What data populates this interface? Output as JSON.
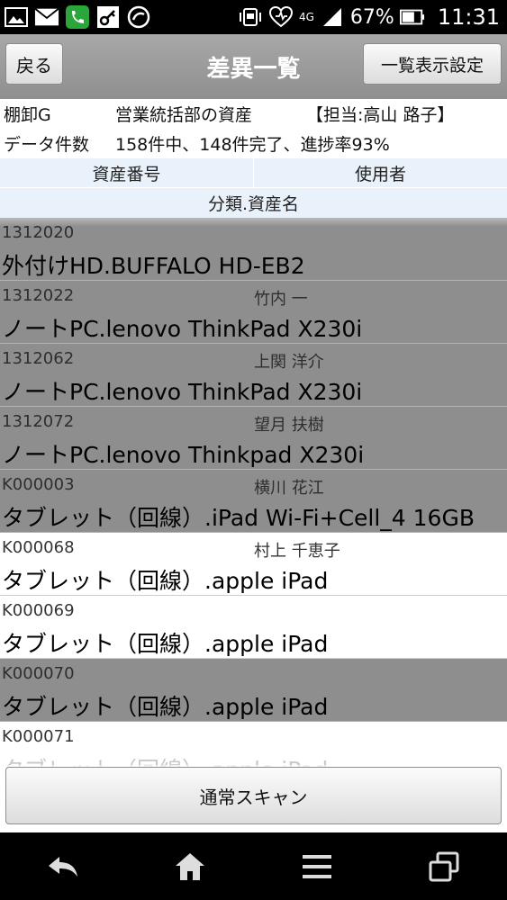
{
  "status_bar": {
    "battery_percent": "67%",
    "network": "4G",
    "time": "11:31"
  },
  "header": {
    "back_label": "戻る",
    "title": "差異一覧",
    "settings_label": "一覧表示設定"
  },
  "info": {
    "group": "棚卸G",
    "department": "営業統括部の資産",
    "owner": "【担当:高山 路子】",
    "count_label": "データ件数",
    "count_value": "158件中、148件完了、進捗率93%"
  },
  "columns": {
    "asset_no": "資産番号",
    "user": "使用者",
    "category_name": "分類.資産名"
  },
  "rows": [
    {
      "asset_no": "1312020",
      "user": "",
      "name": "外付けHD.BUFFALO HD-EB2",
      "style": "gray"
    },
    {
      "asset_no": "1312022",
      "user": "竹内 一",
      "name": "ノートPC.lenovo ThinkPad X230i",
      "style": "gray"
    },
    {
      "asset_no": "1312062",
      "user": "上関 洋介",
      "name": "ノートPC.lenovo ThinkPad X230i",
      "style": "gray"
    },
    {
      "asset_no": "1312072",
      "user": "望月 扶樹",
      "name": "ノートPC.lenovo Thinkpad X230i",
      "style": "gray"
    },
    {
      "asset_no": "K000003",
      "user": "横川 花江",
      "name": "タブレット（回線）.iPad Wi-Fi+Cell_4 16GB",
      "style": "gray"
    },
    {
      "asset_no": "K000068",
      "user": "村上 千恵子",
      "name": "タブレット（回線）.apple iPad",
      "style": "white"
    },
    {
      "asset_no": "K000069",
      "user": "",
      "name": "タブレット（回線）.apple iPad",
      "style": "white"
    },
    {
      "asset_no": "K000070",
      "user": "",
      "name": "タブレット（回線）.apple iPad",
      "style": "gray"
    },
    {
      "asset_no": "K000071",
      "user": "",
      "name": "タブレット（回線）.apple iPad",
      "style": "white"
    }
  ],
  "scan_button_label": "通常スキャン",
  "icons": {
    "status_left": [
      "gallery-icon",
      "mail-icon",
      "phone-app-icon",
      "key-icon",
      "browser-icon"
    ],
    "status_right": [
      "vibrate-icon",
      "heart-icon",
      "signal-icon",
      "battery-icon"
    ],
    "nav": [
      "back-icon",
      "home-icon",
      "menu-icon",
      "recent-apps-icon"
    ]
  }
}
